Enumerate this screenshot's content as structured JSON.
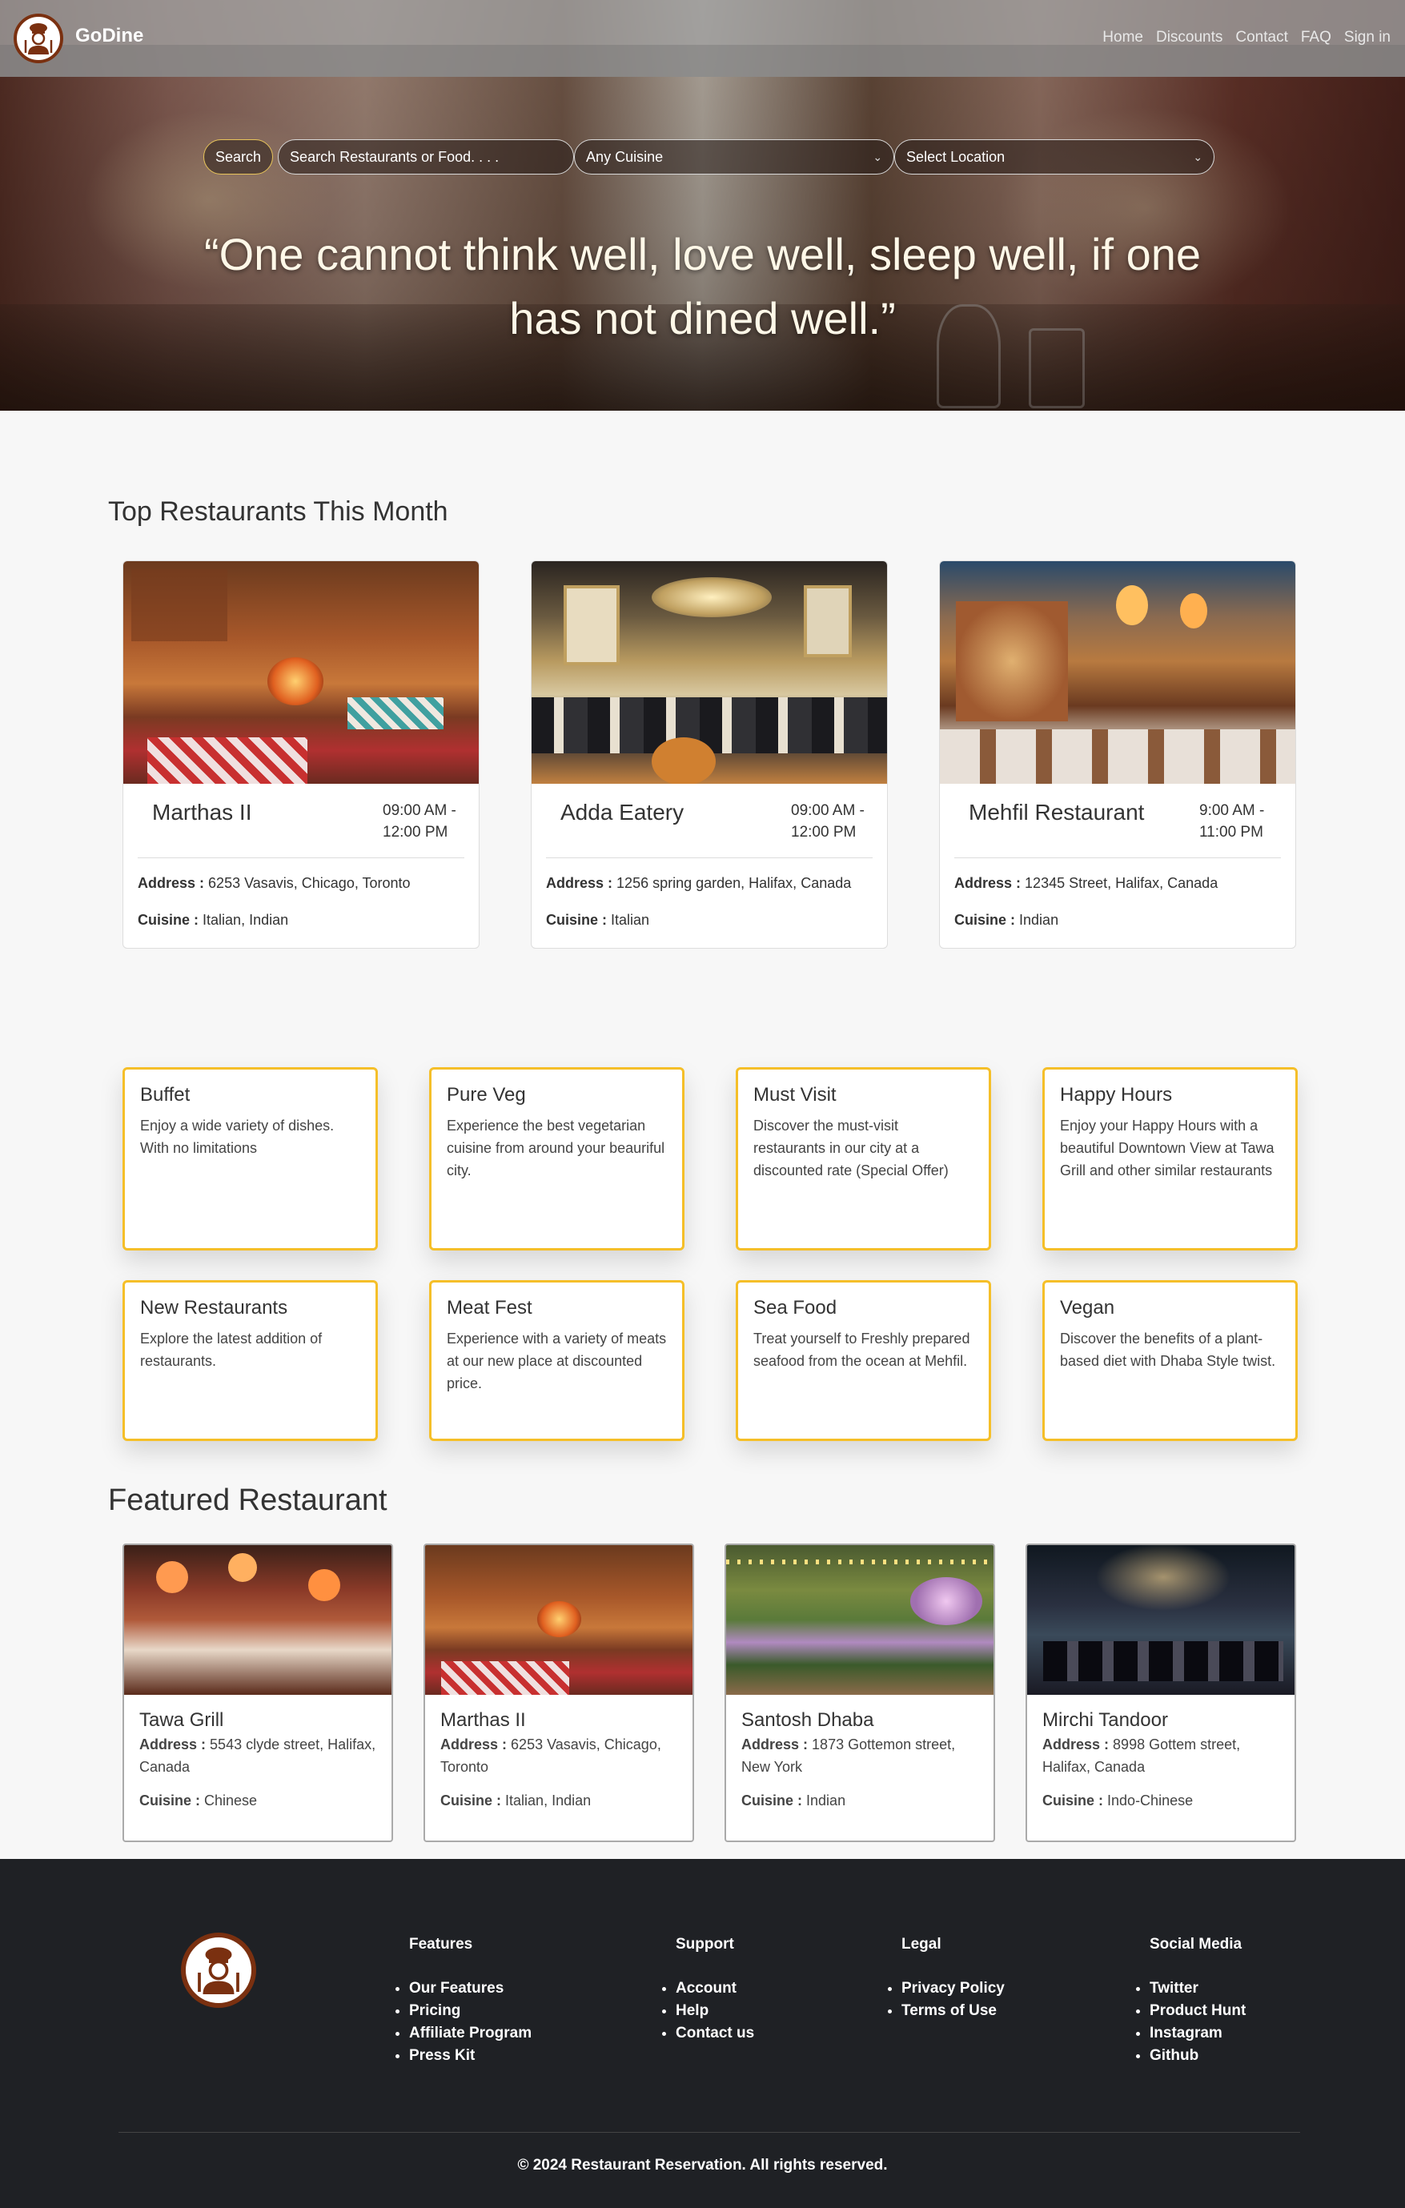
{
  "nav": {
    "brand": "GoDine",
    "links": [
      "Home",
      "Discounts",
      "Contact",
      "FAQ",
      "Sign in"
    ]
  },
  "hero": {
    "search_label": "Search",
    "search_placeholder": "Search Restaurants or Food. . . .",
    "cuisine_select": "Any Cuisine",
    "location_select": "Select Location",
    "quote": "“One cannot think well, love well, sleep well, if one has not dined well.”"
  },
  "top": {
    "title": "Top Restaurants This Month",
    "address_label": "Address :",
    "cuisine_label": "Cuisine :",
    "cards": [
      {
        "name": "Marthas II",
        "time": "09:00 AM - 12:00 PM",
        "address": "6253 Vasavis, Chicago, Toronto",
        "cuisine": "Italian, Indian"
      },
      {
        "name": "Adda Eatery",
        "time": "09:00 AM - 12:00 PM",
        "address": "1256 spring garden, Halifax, Canada",
        "cuisine": "Italian"
      },
      {
        "name": "Mehfil Restaurant",
        "time": "9:00 AM - 11:00 PM",
        "address": "12345 Street, Halifax, Canada",
        "cuisine": "Indian"
      }
    ]
  },
  "features": [
    {
      "title": "Buffet",
      "desc": "Enjoy a wide variety of dishes. With no limitations"
    },
    {
      "title": "Pure Veg",
      "desc": "Experience the best vegetarian cuisine from around your beauriful city."
    },
    {
      "title": "Must Visit",
      "desc": "Discover the must-visit restaurants in our city at a discounted rate (Special Offer)"
    },
    {
      "title": "Happy Hours",
      "desc": "Enjoy your Happy Hours with a beautiful Downtown View at Tawa Grill and other similar restaurants"
    },
    {
      "title": "New Restaurants",
      "desc": "Explore the latest addition of restaurants."
    },
    {
      "title": "Meat Fest",
      "desc": "Experience with a variety of meats at our new place at discounted price."
    },
    {
      "title": "Sea Food",
      "desc": "Treat yourself to Freshly prepared seafood from the ocean at Mehfil."
    },
    {
      "title": "Vegan",
      "desc": "Discover the benefits of a plant-based diet with Dhaba Style twist."
    }
  ],
  "featured": {
    "title": "Featured Restaurant",
    "address_label": "Address :",
    "cuisine_label": "Cuisine :",
    "cards": [
      {
        "name": "Tawa Grill",
        "address": "5543 clyde street, Halifax, Canada",
        "cuisine": "Chinese"
      },
      {
        "name": "Marthas II",
        "address": "6253 Vasavis, Chicago, Toronto",
        "cuisine": "Italian, Indian"
      },
      {
        "name": "Santosh Dhaba",
        "address": "1873 Gottemon street, New York",
        "cuisine": "Indian"
      },
      {
        "name": "Mirchi Tandoor",
        "address": "8998 Gottem street, Halifax, Canada",
        "cuisine": "Indo-Chinese"
      }
    ]
  },
  "footer": {
    "columns": [
      {
        "heading": "Features",
        "items": [
          "Our Features",
          "Pricing",
          "Affiliate Program",
          "Press Kit"
        ]
      },
      {
        "heading": "Support",
        "items": [
          "Account",
          "Help",
          "Contact us"
        ]
      },
      {
        "heading": "Legal",
        "items": [
          "Privacy Policy",
          "Terms of Use"
        ]
      },
      {
        "heading": "Social Media",
        "items": [
          "Twitter",
          "Product Hunt",
          "Instagram",
          "Github"
        ]
      }
    ],
    "copyright": "© 2024 Restaurant Reservation. All rights reserved."
  },
  "colors": {
    "accent": "#f5bf29",
    "footer_bg": "#1f2125",
    "logo_ring": "#7a3010"
  },
  "icons": [
    "chef-logo-icon",
    "chevron-down-icon"
  ]
}
